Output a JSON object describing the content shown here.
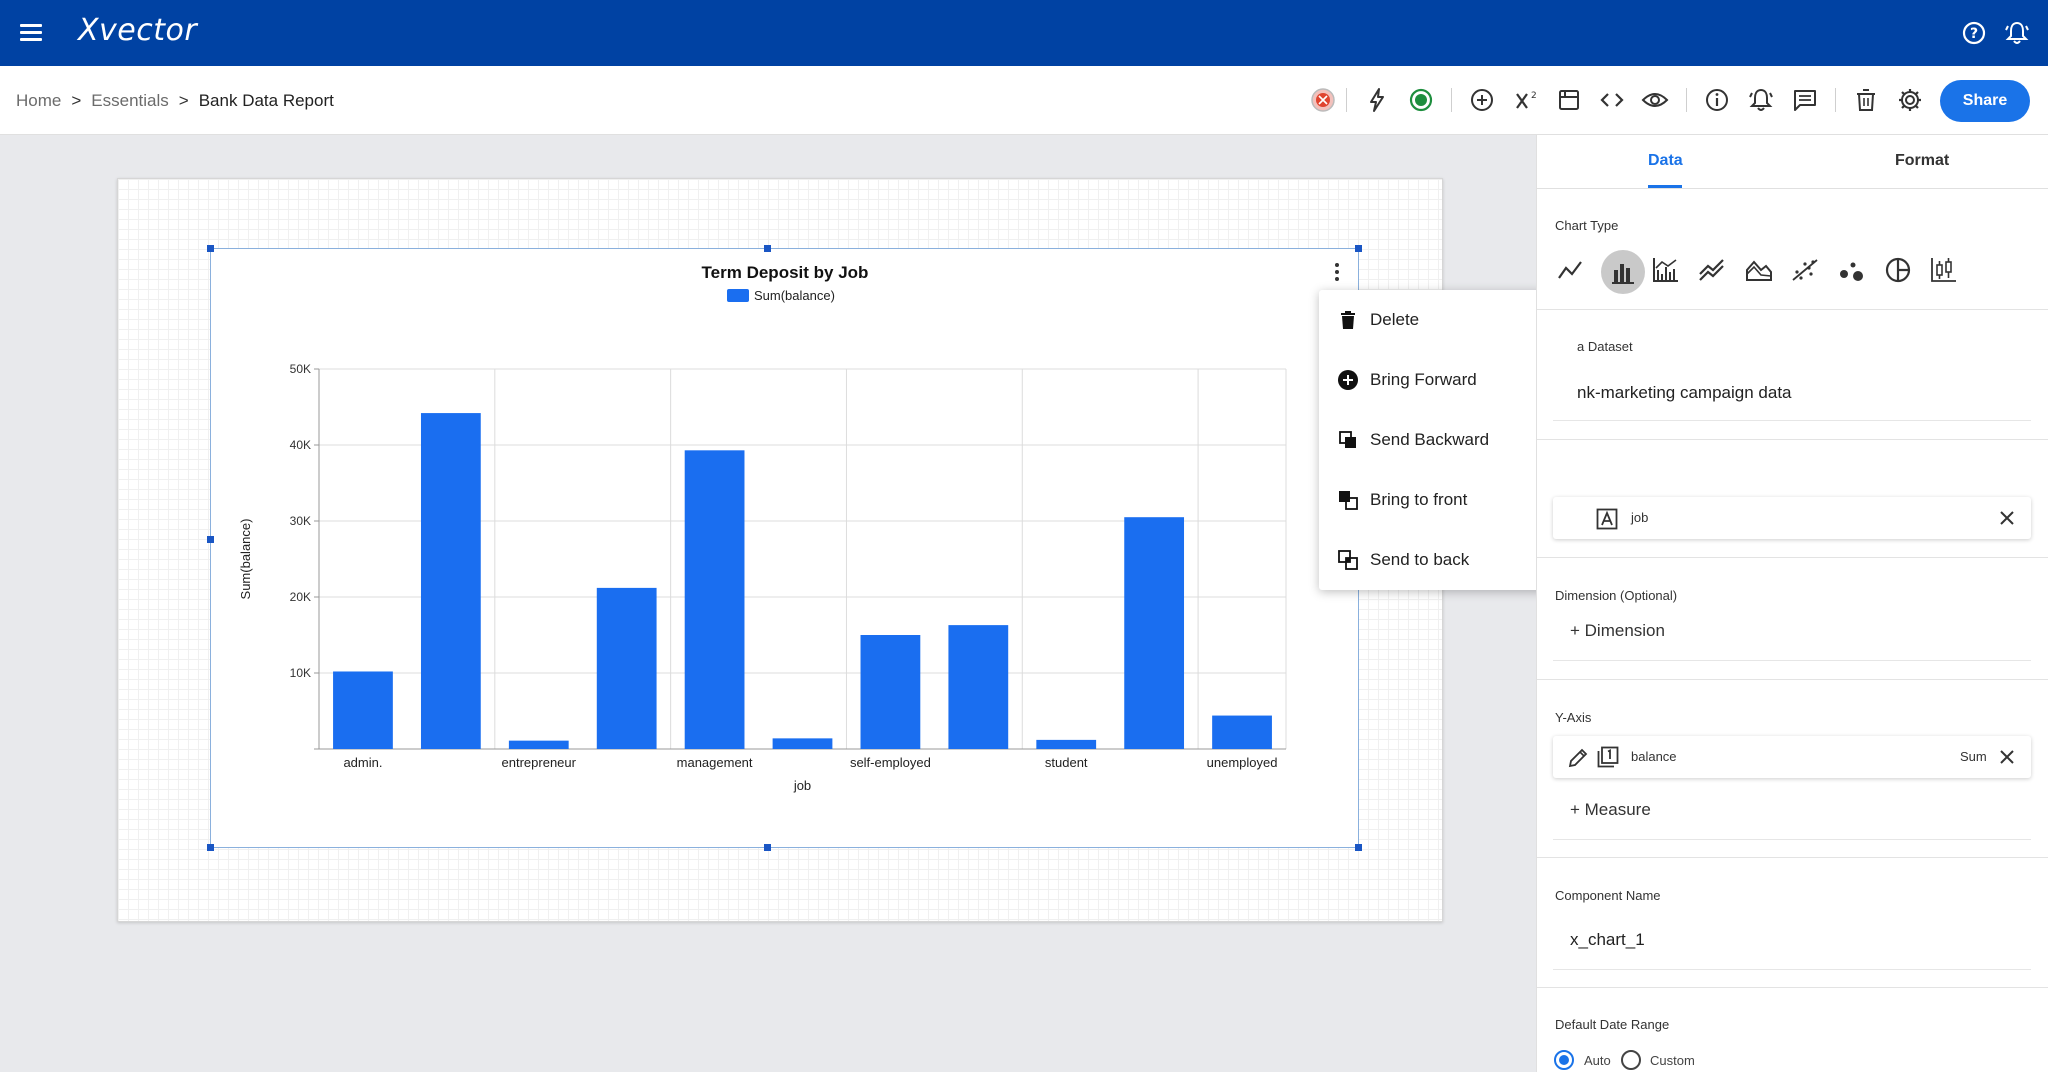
{
  "app": {
    "logo": "Xvector"
  },
  "breadcrumb": {
    "home": "Home",
    "sep1": ">",
    "essentials": "Essentials",
    "sep2": ">",
    "current": "Bank Data Report"
  },
  "toolbar": {
    "share_label": "Share"
  },
  "context_menu": {
    "delete": "Delete",
    "bring_forward": "Bring Forward",
    "send_backward": "Send Backward",
    "bring_to_front": "Bring to front",
    "send_to_back": "Send to back"
  },
  "panel": {
    "tabs": {
      "data": "Data",
      "format": "Format"
    },
    "chart_type_label": "Chart Type",
    "dataset_label": "a Dataset",
    "dataset_value": "nk-marketing campaign data",
    "x_field": "job",
    "dimension_label": "Dimension (Optional)",
    "add_dimension": "+ Dimension",
    "y_axis_label": "Y-Axis",
    "y_field": "balance",
    "y_agg": "Sum",
    "add_measure": "+ Measure",
    "component_name_label": "Component Name",
    "component_name_value": "x_chart_1",
    "date_range_label": "Default Date Range",
    "radio_auto": "Auto",
    "radio_custom": "Custom"
  },
  "colors": {
    "bar": "#1a6ef0",
    "brand": "#0042a3",
    "accent": "#1a73e8"
  },
  "chart_data": {
    "type": "bar",
    "title": "Term Deposit by Job",
    "legend": [
      "Sum(balance)"
    ],
    "xlabel": "job",
    "ylabel": "Sum(balance)",
    "ylim": [
      0,
      50000
    ],
    "yticks": [
      "10K",
      "20K",
      "30K",
      "40K",
      "50K"
    ],
    "categories": [
      "admin.",
      "",
      "entrepreneur",
      "",
      "management",
      "",
      "self-employed",
      "",
      "student",
      "",
      "unemployed"
    ],
    "series": [
      {
        "name": "Sum(balance)",
        "values": [
          10200,
          44200,
          1100,
          21200,
          39300,
          1400,
          15000,
          16300,
          1200,
          30500,
          4400
        ]
      }
    ]
  }
}
